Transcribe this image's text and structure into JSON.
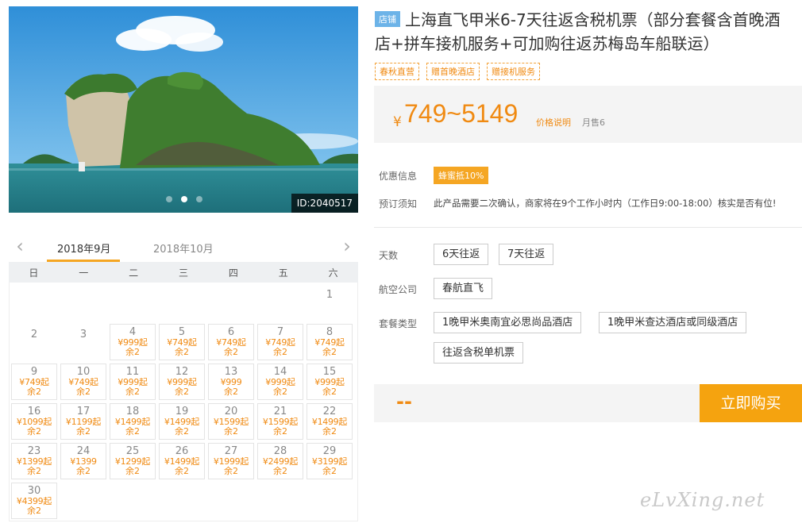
{
  "photo": {
    "id_label": "ID:2040517",
    "dot_count": 3,
    "active_dot": 1
  },
  "calendar": {
    "months": [
      "2018年9月",
      "2018年10月"
    ],
    "active_month": 0,
    "weekdays": [
      "日",
      "一",
      "二",
      "三",
      "四",
      "五",
      "六"
    ],
    "days": [
      {
        "day": "",
        "price": "",
        "left": ""
      },
      {
        "day": "",
        "price": "",
        "left": ""
      },
      {
        "day": "",
        "price": "",
        "left": ""
      },
      {
        "day": "",
        "price": "",
        "left": ""
      },
      {
        "day": "",
        "price": "",
        "left": ""
      },
      {
        "day": "",
        "price": "",
        "left": ""
      },
      {
        "day": "1",
        "price": "",
        "left": ""
      },
      {
        "day": "2",
        "price": "",
        "left": ""
      },
      {
        "day": "3",
        "price": "",
        "left": ""
      },
      {
        "day": "4",
        "price": "¥999起",
        "left": "余2"
      },
      {
        "day": "5",
        "price": "¥749起",
        "left": "余2"
      },
      {
        "day": "6",
        "price": "¥749起",
        "left": "余2"
      },
      {
        "day": "7",
        "price": "¥749起",
        "left": "余2"
      },
      {
        "day": "8",
        "price": "¥749起",
        "left": "余2"
      },
      {
        "day": "9",
        "price": "¥749起",
        "left": "余2"
      },
      {
        "day": "10",
        "price": "¥749起",
        "left": "余2"
      },
      {
        "day": "11",
        "price": "¥999起",
        "left": "余2"
      },
      {
        "day": "12",
        "price": "¥999起",
        "left": "余2"
      },
      {
        "day": "13",
        "price": "¥999",
        "left": "余2"
      },
      {
        "day": "14",
        "price": "¥999起",
        "left": "余2"
      },
      {
        "day": "15",
        "price": "¥999起",
        "left": "余2"
      },
      {
        "day": "16",
        "price": "¥1099起",
        "left": "余2"
      },
      {
        "day": "17",
        "price": "¥1199起",
        "left": "余2"
      },
      {
        "day": "18",
        "price": "¥1499起",
        "left": "余2"
      },
      {
        "day": "19",
        "price": "¥1499起",
        "left": "余2"
      },
      {
        "day": "20",
        "price": "¥1599起",
        "left": "余2"
      },
      {
        "day": "21",
        "price": "¥1599起",
        "left": "余2"
      },
      {
        "day": "22",
        "price": "¥1499起",
        "left": "余2"
      },
      {
        "day": "23",
        "price": "¥1399起",
        "left": "余2"
      },
      {
        "day": "24",
        "price": "¥1399",
        "left": "余2"
      },
      {
        "day": "25",
        "price": "¥1299起",
        "left": "余2"
      },
      {
        "day": "26",
        "price": "¥1499起",
        "left": "余2"
      },
      {
        "day": "27",
        "price": "¥1999起",
        "left": "余2"
      },
      {
        "day": "28",
        "price": "¥2499起",
        "left": "余2"
      },
      {
        "day": "29",
        "price": "¥3199起",
        "left": "余2"
      },
      {
        "day": "30",
        "price": "¥4399起",
        "left": "余2"
      }
    ]
  },
  "product": {
    "shop_badge": "店铺",
    "title": "上海直飞甲米6-7天往返含税机票（部分套餐含首晚酒店+拼车接机服务+可加购往返苏梅岛车船联运）",
    "tags": [
      "春秋直营",
      "赠首晚酒店",
      "赠接机服务"
    ]
  },
  "price": {
    "currency": "¥",
    "range": "749~5149",
    "explain_link": "价格说明",
    "sold": "月售6"
  },
  "promo": {
    "label": "优惠信息",
    "badge": "蜂蜜抵10%"
  },
  "notice": {
    "label": "预订须知",
    "text": "此产品需要二次确认，商家将在9个工作小时内（工作日9:00-18:00）核实是否有位!"
  },
  "options": {
    "days_label": "天数",
    "days": [
      "6天往返",
      "7天往返"
    ],
    "airline_label": "航空公司",
    "airlines": [
      "春航直飞"
    ],
    "package_label": "套餐类型",
    "packages": [
      "1晚甲米奥南宜必思尚品酒店",
      "1晚甲米查达酒店或同级酒店",
      "往返含税单机票"
    ]
  },
  "buy": {
    "total": "--",
    "button": "立即购买"
  },
  "watermark": "eLvXing.net",
  "colors": {
    "accent": "#f5a623",
    "price": "#f08a12",
    "badge_blue": "#6cb3e8"
  }
}
